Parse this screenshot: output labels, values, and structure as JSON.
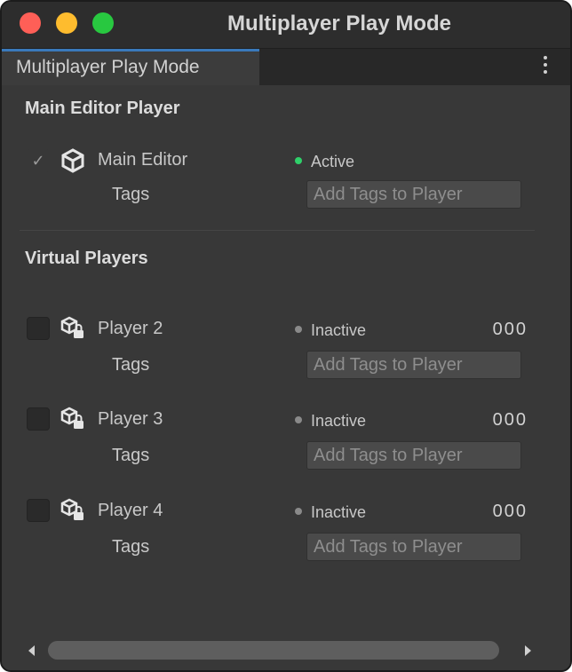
{
  "window": {
    "title": "Multiplayer Play Mode"
  },
  "tab": {
    "label": "Multiplayer Play Mode"
  },
  "main_section": {
    "title": "Main Editor Player",
    "player": {
      "name": "Main Editor",
      "checked": true,
      "status": "Active",
      "status_color": "#2fd06a",
      "tags_label": "Tags",
      "tags_placeholder": "Add Tags to Player",
      "icon": "unity-logo-icon"
    }
  },
  "virtual_section": {
    "title": "Virtual Players",
    "players": [
      {
        "name": "Player 2",
        "checked": false,
        "status": "Inactive",
        "counter": "000",
        "tags_label": "Tags",
        "tags_placeholder": "Add Tags to Player",
        "icon": "unity-locked-icon"
      },
      {
        "name": "Player 3",
        "checked": false,
        "status": "Inactive",
        "counter": "000",
        "tags_label": "Tags",
        "tags_placeholder": "Add Tags to Player",
        "icon": "unity-locked-icon"
      },
      {
        "name": "Player 4",
        "checked": false,
        "status": "Inactive",
        "counter": "000",
        "tags_label": "Tags",
        "tags_placeholder": "Add Tags to Player",
        "icon": "unity-locked-icon"
      }
    ]
  },
  "colors": {
    "background": "#383838",
    "accent_tab": "#3a79bb",
    "active": "#2fd06a",
    "inactive": "#8a8a8a"
  }
}
